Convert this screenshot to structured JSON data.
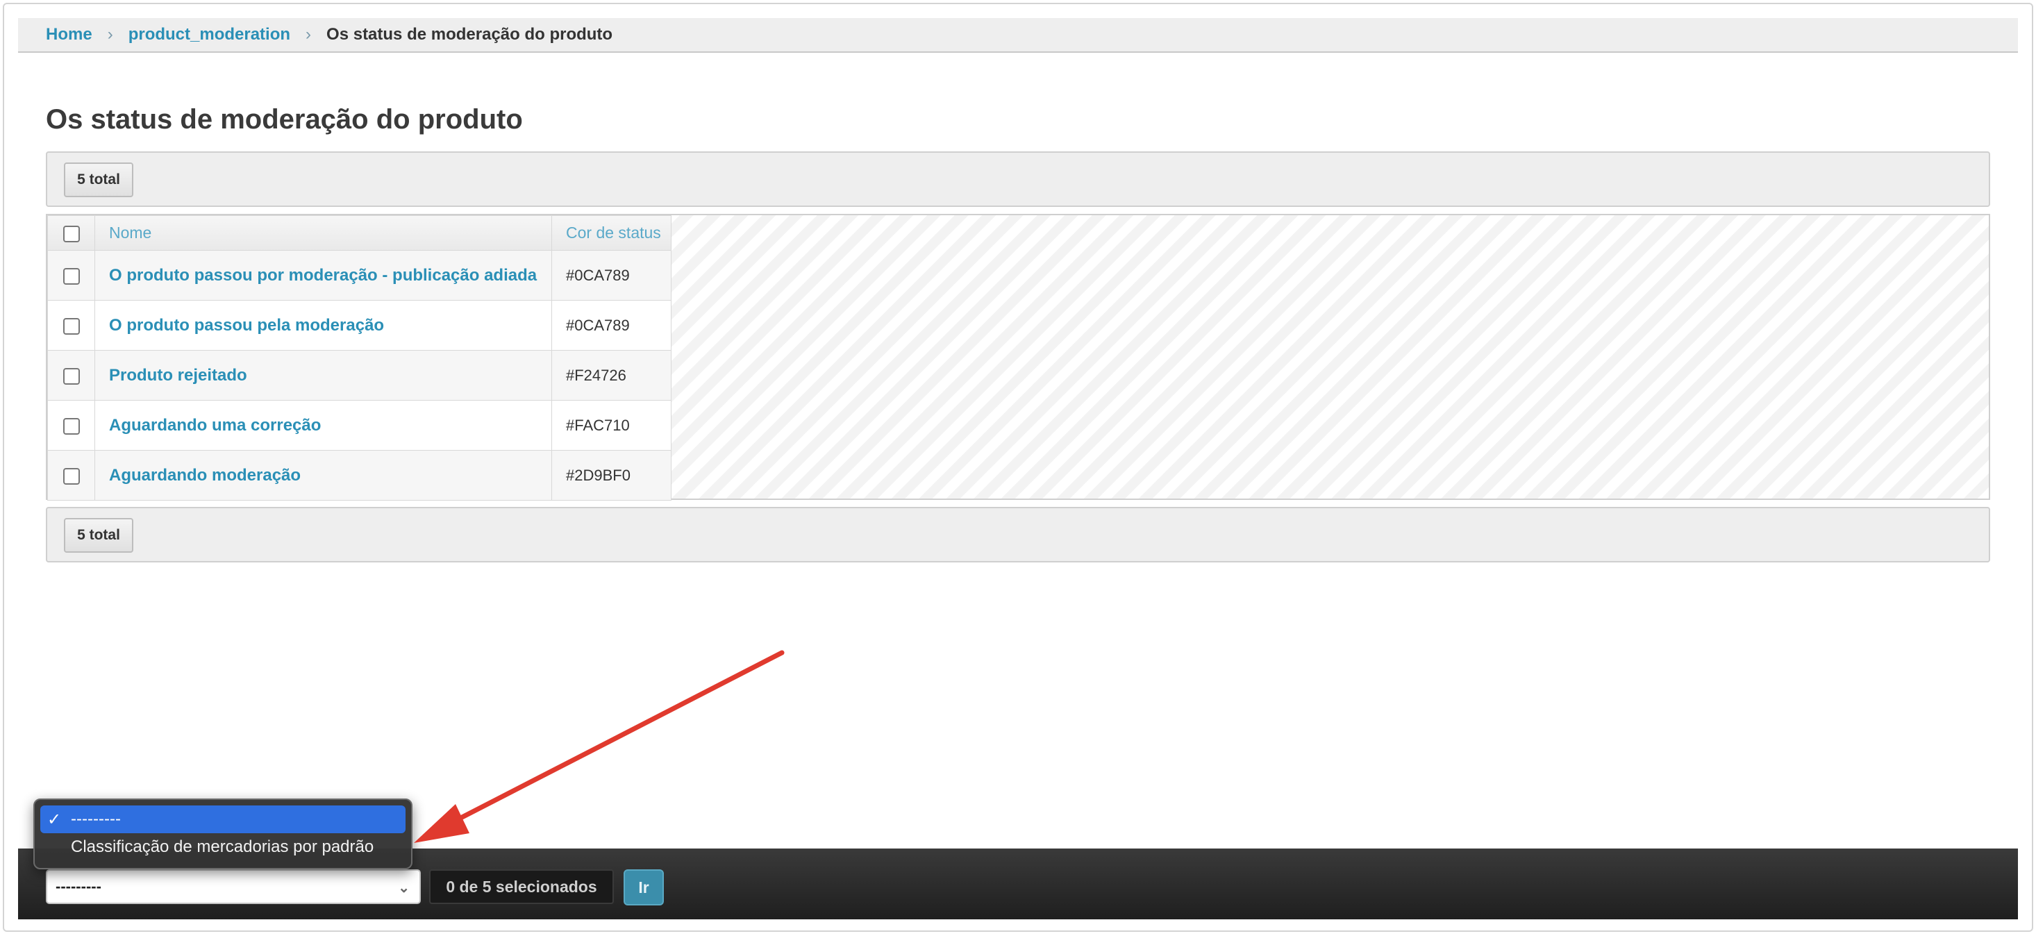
{
  "breadcrumb": {
    "home": "Home",
    "section": "product_moderation",
    "current": "Os status de moderação do produto"
  },
  "page": {
    "title": "Os status de moderação do produto"
  },
  "toolbar": {
    "total_label": "5 total"
  },
  "table": {
    "headers": {
      "name": "Nome",
      "color": "Cor de status"
    },
    "rows": [
      {
        "name": "O produto passou por moderação - publicação adiada",
        "color": "#0CA789"
      },
      {
        "name": "O produto passou pela moderação",
        "color": "#0CA789"
      },
      {
        "name": "Produto rejeitado",
        "color": "#F24726"
      },
      {
        "name": "Aguardando uma correção",
        "color": "#FAC710"
      },
      {
        "name": "Aguardando moderação",
        "color": "#2D9BF0"
      }
    ]
  },
  "actions": {
    "select_value": "---------",
    "options": [
      "---------",
      "Classificação de mercadorias por padrão"
    ],
    "selected_count": "0 de 5 selecionados",
    "go_label": "Ir"
  },
  "icons": {
    "breadcrumb_separator": "chevron-right-icon",
    "select_chevron": "chevron-updown-icon",
    "selected_option": "check-icon"
  },
  "colors": {
    "link": "#2a8fb6",
    "go_button": "#3b8eab",
    "menu_highlight": "#2f6fe0",
    "annotation_arrow": "#e03a2e"
  }
}
